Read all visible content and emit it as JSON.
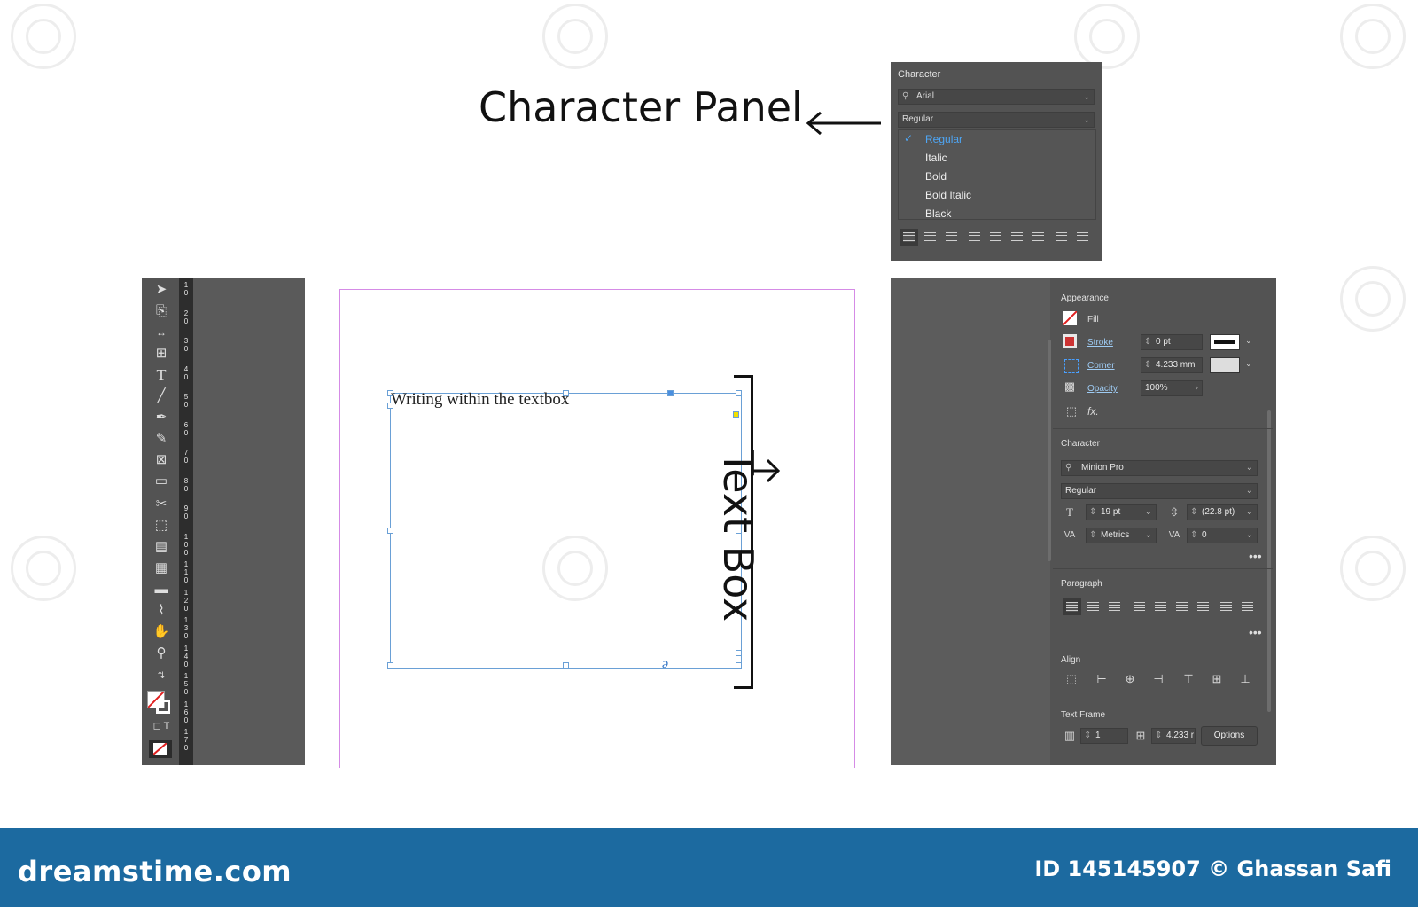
{
  "annotations": {
    "character_panel": "Character Panel",
    "text_box": "Text Box"
  },
  "char_popup": {
    "title": "Character",
    "font": "Arial",
    "style": "Regular",
    "menu": [
      "Regular",
      "Italic",
      "Bold",
      "Bold Italic",
      "Black"
    ],
    "selected_index": 0
  },
  "ruler_ticks": [
    "1\n0",
    "2\n0",
    "3\n0",
    "4\n0",
    "5\n0",
    "6\n0",
    "7\n0",
    "8\n0",
    "9\n0",
    "1\n0\n0",
    "1\n1\n0",
    "1\n2\n0",
    "1\n3\n0",
    "1\n4\n0",
    "1\n5\n0",
    "1\n6\n0",
    "1\n7\n0"
  ],
  "frame": {
    "text": "Writing within the textbox",
    "overset_glyph": "ə"
  },
  "properties": {
    "appearance": {
      "title": "Appearance",
      "fill_label": "Fill",
      "stroke_label": "Stroke",
      "stroke_value": "0 pt",
      "corner_label": "Corner",
      "corner_value": "4.233 mm",
      "opacity_label": "Opacity",
      "opacity_value": "100%",
      "fx_label": "fx."
    },
    "character": {
      "title": "Character",
      "font": "Minion Pro",
      "style": "Regular",
      "size": "19 pt",
      "leading": "(22.8 pt)",
      "kerning": "Metrics",
      "tracking": "0"
    },
    "paragraph": {
      "title": "Paragraph"
    },
    "align": {
      "title": "Align"
    },
    "text_frame": {
      "title": "Text Frame",
      "columns": "1",
      "gutter": "4.233 r",
      "options_label": "Options"
    }
  },
  "footer": {
    "brand": "dreamstime.com",
    "credit": "ID 145145907 © Ghassan Safi"
  }
}
